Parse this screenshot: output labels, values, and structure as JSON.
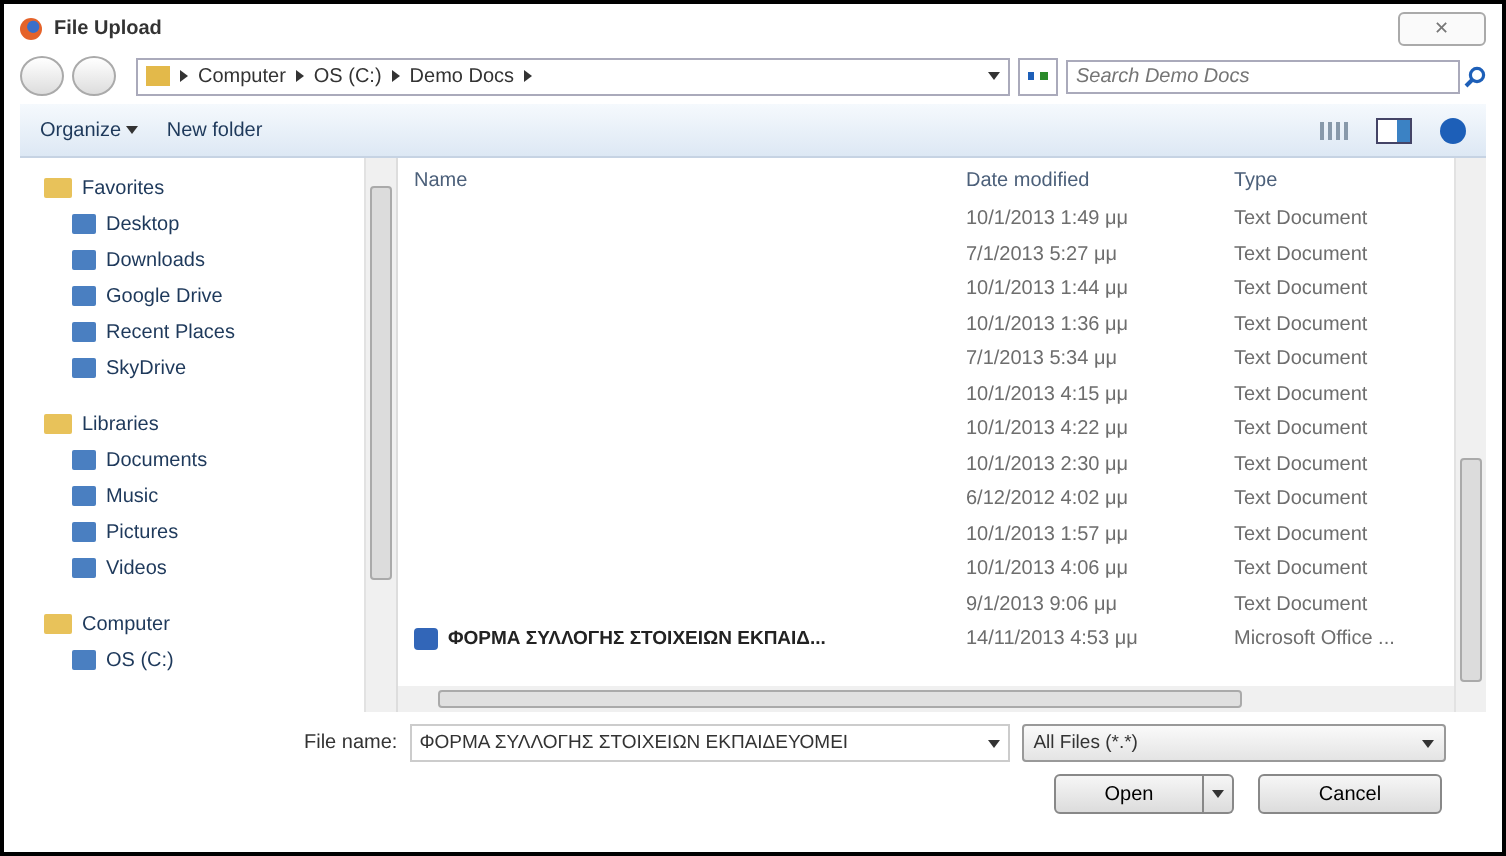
{
  "window": {
    "title": "File Upload",
    "close": "✕"
  },
  "address": {
    "path": [
      "Computer",
      "OS (C:)",
      "Demo Docs"
    ]
  },
  "search": {
    "placeholder": "Search Demo Docs"
  },
  "toolbar": {
    "organize": "Organize",
    "new_folder": "New folder"
  },
  "sidebar": {
    "groups": [
      {
        "label": "Favorites",
        "children": [
          {
            "label": "Desktop"
          },
          {
            "label": "Downloads"
          },
          {
            "label": "Google Drive"
          },
          {
            "label": "Recent Places"
          },
          {
            "label": "SkyDrive"
          }
        ]
      },
      {
        "label": "Libraries",
        "children": [
          {
            "label": "Documents"
          },
          {
            "label": "Music"
          },
          {
            "label": "Pictures"
          },
          {
            "label": "Videos"
          }
        ]
      },
      {
        "label": "Computer",
        "children": [
          {
            "label": "OS (C:)"
          }
        ]
      }
    ]
  },
  "table": {
    "columns": [
      "Name",
      "Date modified",
      "Type"
    ],
    "rows": [
      {
        "date": "10/1/2013 1:49 μμ",
        "type": "Text Document"
      },
      {
        "date": "7/1/2013 5:27 μμ",
        "type": "Text Document"
      },
      {
        "date": "10/1/2013 1:44 μμ",
        "type": "Text Document"
      },
      {
        "date": "10/1/2013 1:36 μμ",
        "type": "Text Document"
      },
      {
        "date": "7/1/2013 5:34 μμ",
        "type": "Text Document"
      },
      {
        "date": "10/1/2013 4:15 μμ",
        "type": "Text Document"
      },
      {
        "date": "10/1/2013 4:22 μμ",
        "type": "Text Document"
      },
      {
        "date": "10/1/2013 2:30 μμ",
        "type": "Text Document"
      },
      {
        "date": "6/12/2012 4:02 μμ",
        "type": "Text Document"
      },
      {
        "date": "10/1/2013 1:57 μμ",
        "type": "Text Document"
      },
      {
        "date": "10/1/2013 4:06 μμ",
        "type": "Text Document"
      },
      {
        "date": "9/1/2013 9:06 μμ",
        "type": "Text Document"
      },
      {
        "name": "ΦΟΡΜΑ ΣΥΛΛΟΓΗΣ ΣΤΟΙΧΕΙΩΝ ΕΚΠΑΙΔ...",
        "date": "14/11/2013 4:53 μμ",
        "type": "Microsoft Office ..."
      }
    ]
  },
  "file_name": {
    "label": "File name:",
    "value": "ΦΟΡΜΑ ΣΥΛΛΟΓΗΣ ΣΤΟΙΧΕΙΩΝ ΕΚΠΑΙΔΕΥΟΜΕΙ"
  },
  "file_type": {
    "value": "All Files (*.*)"
  },
  "buttons": {
    "open": "Open",
    "cancel": "Cancel"
  }
}
